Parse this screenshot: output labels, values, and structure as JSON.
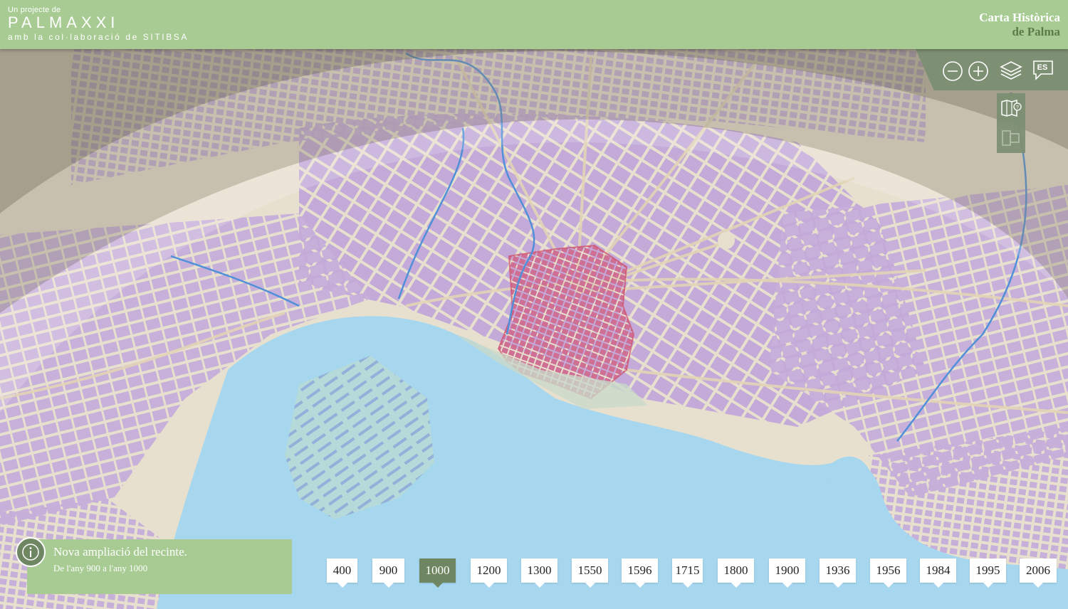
{
  "header": {
    "brand_pre": "Un projecte de",
    "brand_name": "PALMAXXI",
    "brand_sub": "amb la col·laboració de SITIBSA",
    "title_line1": "Carta Històrica",
    "title_line2": "de Palma"
  },
  "toolbar": {
    "zoom_out_icon": "minus-circle-icon",
    "zoom_in_icon": "plus-circle-icon",
    "layers_icon": "layers-icon",
    "language": "ES",
    "side_icons": [
      "map-help-icon",
      "map-compare-icon"
    ]
  },
  "info": {
    "icon": "info-icon",
    "title": "Nova ampliació del recinte.",
    "subtitle": "De l'any 900 a l'any 1000"
  },
  "timeline": {
    "years": [
      "400",
      "900",
      "1000",
      "1200",
      "1300",
      "1550",
      "1596",
      "1715",
      "1800",
      "1900",
      "1936",
      "1956",
      "1984",
      "1995",
      "2006"
    ],
    "selected": "1000"
  },
  "colors": {
    "header": "#a7cb93",
    "accent_dark": "#6e8662",
    "toolbar": "#7e9073",
    "sea": "#a6d7ee",
    "land": "#e8e0cf",
    "buildings": "#c1a6d6",
    "historic_core": "#cf6f93",
    "river": "#4f90d8"
  }
}
